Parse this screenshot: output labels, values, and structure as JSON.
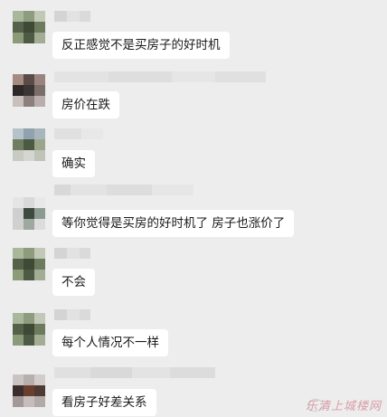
{
  "messages": [
    {
      "text": "反正感觉不是买房子的好时机"
    },
    {
      "text": "房价在跌"
    },
    {
      "text": "确实"
    },
    {
      "text": "等你觉得是买房的好时机了 房子也涨价了"
    },
    {
      "text": "不会"
    },
    {
      "text": "每个人情况不一样"
    },
    {
      "text": "看房子好差关系"
    }
  ],
  "watermark": "乐清上城楼网"
}
